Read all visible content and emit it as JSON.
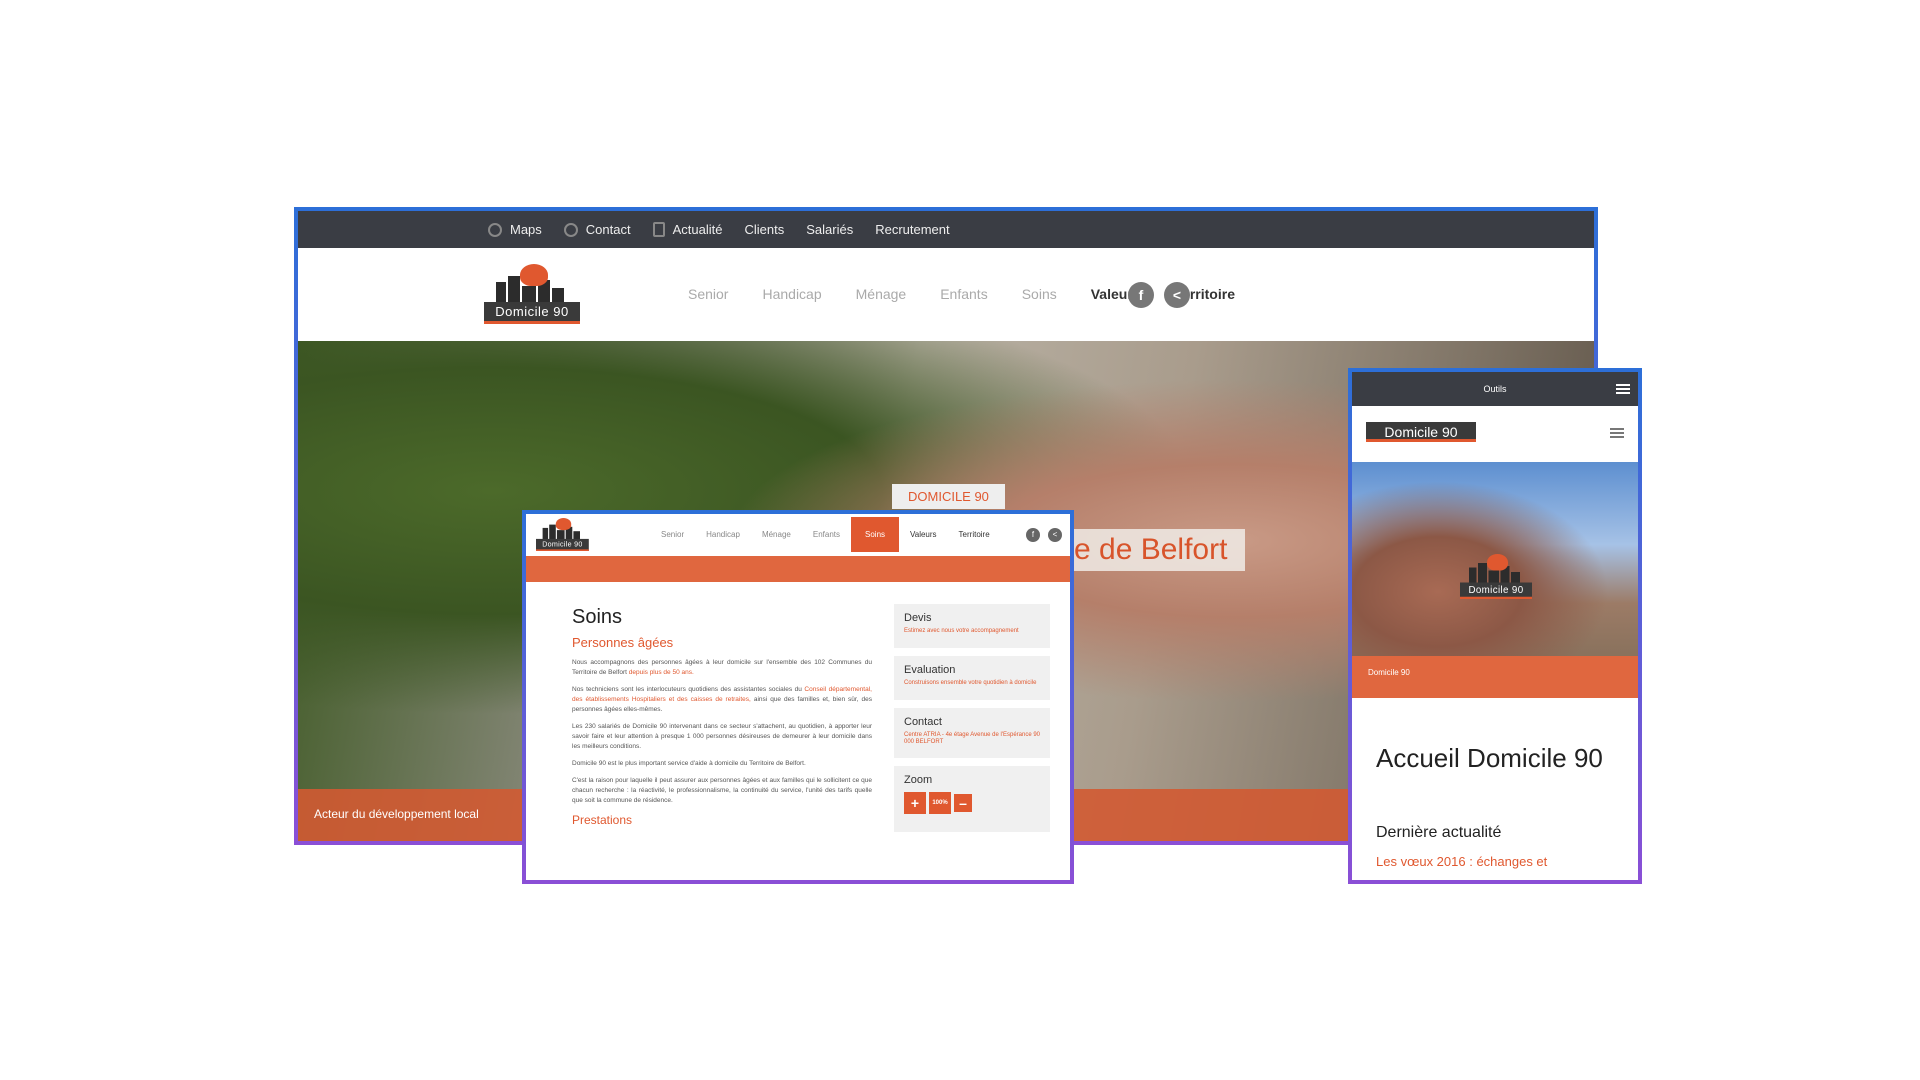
{
  "desktop": {
    "topbar": {
      "maps": "Maps",
      "contact": "Contact",
      "actualite": "Actualité",
      "clients": "Clients",
      "salaries": "Salariés",
      "recrutement": "Recrutement"
    },
    "logo_text": "Domicile 90",
    "nav": [
      "Senior",
      "Handicap",
      "Ménage",
      "Enfants",
      "Soins"
    ],
    "nav_bold": [
      "Valeurs",
      "Territoire"
    ],
    "hero_tag": "DOMICILE 90",
    "hero_title": "re de Belfort",
    "hero_band": "Acteur du développement local"
  },
  "tablet": {
    "nav": [
      "Senior",
      "Handicap",
      "Ménage",
      "Enfants"
    ],
    "nav_active": "Soins",
    "nav_bold": [
      "Valeurs",
      "Territoire"
    ],
    "title": "Soins",
    "subtitle": "Personnes âgées",
    "p1": "Nous accompagnons des personnes âgées à leur domicile sur l'ensemble des 102 Communes du Territoire de Belfort",
    "p1_hl": "depuis plus de 50 ans.",
    "p2": "Nos techniciens sont les interlocuteurs quotidiens des assistantes sociales du",
    "p2_hl": "Conseil départemental, des établissements Hospitaliers et des caisses de retraites,",
    "p2_end": "ainsi que des familles et, bien sûr, des personnes âgées elles-mêmes.",
    "p3": "Les 230 salariés de Domicile 90 intervenant dans ce secteur s'attachent, au quotidien, à apporter leur savoir faire et leur attention à presque 1 000 personnes désireuses de demeurer à leur domicile dans les meilleurs conditions.",
    "p4": "Domicile 90 est le plus important service d'aide à domicile du Territoire de Belfort.",
    "p5": "C'est la raison pour laquelle il peut assurer aux personnes âgées et aux familles qui le sollicitent ce que chacun recherche : la réactivité, le professionnalisme, la continuité du service, l'unité des tarifs quelle que soit la commune de résidence.",
    "prestations": "Prestations",
    "side": [
      {
        "title": "Devis",
        "sub": "Estimez avec nous votre accompagnement"
      },
      {
        "title": "Evaluation",
        "sub": "Construisons ensemble votre quotidien à domicile"
      },
      {
        "title": "Contact",
        "sub": "Centre ATRIA - 4e étage Avenue de l'Espérance 90 000 BELFORT"
      }
    ],
    "zoom": {
      "title": "Zoom",
      "plus": "+",
      "mid": "100%",
      "minus": "–"
    }
  },
  "mobile": {
    "top": "Outils",
    "logo_text": "Domicile 90",
    "band": "Domicile 90",
    "title": "Accueil Domicile 90",
    "subtitle": "Dernière actualité",
    "link": "Les vœux 2016 : échanges et"
  },
  "colors": {
    "accent": "#e0582f",
    "dark": "#3a3d44",
    "frame_top": "#2d6fd8",
    "frame_bottom": "#8a4fd6"
  }
}
